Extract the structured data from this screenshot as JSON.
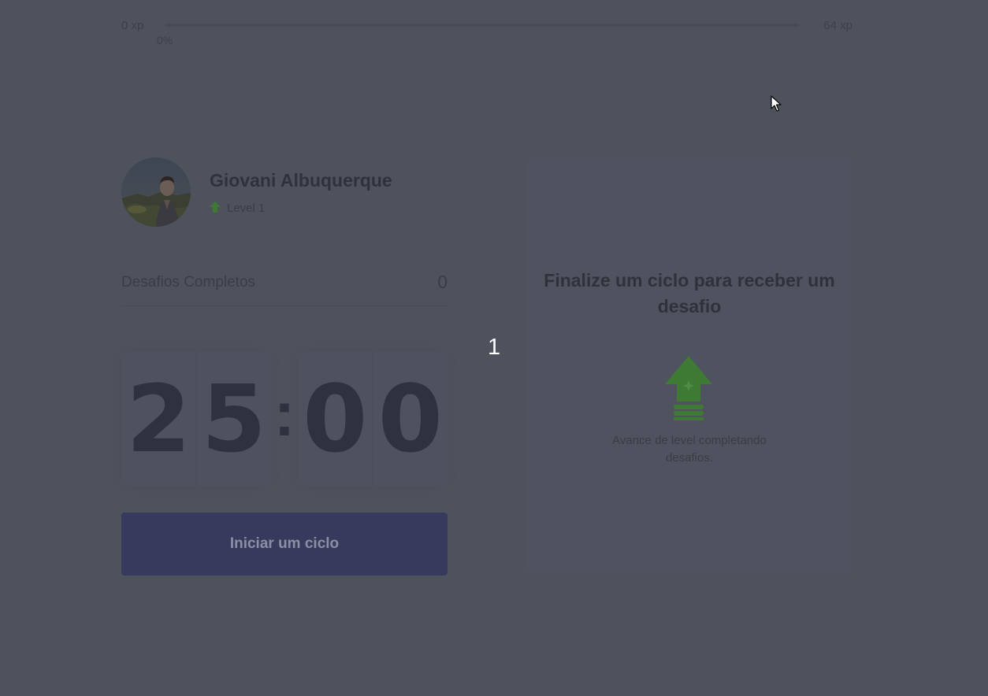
{
  "experience": {
    "min_label": "0 xp",
    "max_label": "64 xp",
    "current_percent_label": "0%",
    "progress_fraction": 0
  },
  "profile": {
    "name": "Giovani Albuquerque",
    "level_label": "Level 1",
    "level_icon": "level-up-arrow-icon",
    "avatar_icon": "avatar-photo"
  },
  "completed_challenges": {
    "label": "Desafios Completos",
    "count": "0"
  },
  "countdown": {
    "minutes": [
      "2",
      "5"
    ],
    "seconds": [
      "0",
      "0"
    ],
    "separator": ":"
  },
  "start_button": {
    "label": "Iniciar um ciclo"
  },
  "overlay": {
    "number": "1"
  },
  "challenge_box": {
    "title": "Finalize um ciclo para receber um desafio",
    "icon": "level-up-icon",
    "hint": "Avance de level completando desafios."
  },
  "colors": {
    "background": "#4e525d",
    "accent_green": "#3f7a34",
    "button": "#373a5c",
    "progress": "#4d5ea8"
  }
}
